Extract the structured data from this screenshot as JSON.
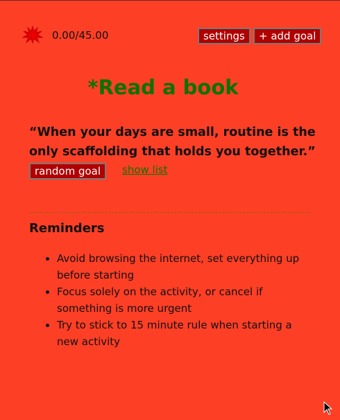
{
  "header": {
    "progress": "0.00/45.00",
    "settings_label": "settings",
    "add_goal_label": "+ add goal",
    "logo_icon": "red-splat-icon"
  },
  "goal": {
    "title": "*Read a book",
    "quote": "“When your days are small, routine is the only scaffolding that holds you together.”",
    "random_label": "random goal",
    "show_list_label": "show list"
  },
  "reminders": {
    "title": "Reminders",
    "items": [
      "Avoid browsing the internet, set everything up before starting",
      "Focus solely on the activity, or cancel if something is more urgent",
      "Try to stick to 15 minute rule when starting a new activity"
    ]
  },
  "colors": {
    "background": "#fd3f26",
    "button": "#b00000",
    "accent_green": "#0c7200"
  }
}
